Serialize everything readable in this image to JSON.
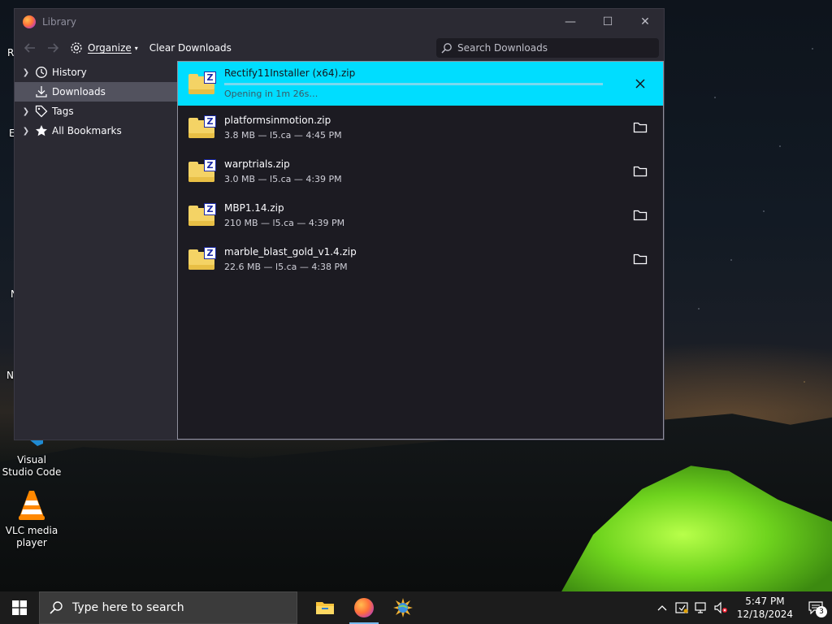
{
  "window": {
    "title": "Library",
    "controls": {
      "minimize": "—",
      "maximize": "☐",
      "close": "✕"
    }
  },
  "toolbar": {
    "back_icon": "arrow-left-icon",
    "forward_icon": "arrow-right-icon",
    "organize_label": "Organize",
    "clear_label": "Clear Downloads",
    "search_placeholder": "Search Downloads"
  },
  "sidebar": {
    "items": [
      {
        "label": "History",
        "icon": "clock-icon",
        "expandable": true
      },
      {
        "label": "Downloads",
        "icon": "download-icon",
        "expandable": false,
        "active": true
      },
      {
        "label": "Tags",
        "icon": "tag-icon",
        "expandable": true
      },
      {
        "label": "All Bookmarks",
        "icon": "star-icon",
        "expandable": true
      }
    ]
  },
  "downloads": [
    {
      "name": "Rectify11Installer (x64).zip",
      "status": "Opening in 1m 26s…",
      "progress": 0.0,
      "selected": true
    },
    {
      "name": "platformsinmotion.zip",
      "status": "3.8 MB — l5.ca — 4:45 PM"
    },
    {
      "name": "warptrials.zip",
      "status": "3.0 MB — l5.ca — 4:39 PM"
    },
    {
      "name": "MBP1.14.zip",
      "status": "210 MB — l5.ca — 4:39 PM"
    },
    {
      "name": "marble_blast_gold_v1.4.zip",
      "status": "22.6 MB — l5.ca — 4:38 PM"
    }
  ],
  "desktop": {
    "icons": [
      {
        "label": "Visual Studio Code"
      },
      {
        "label": "VLC media player"
      }
    ],
    "edge_labels": [
      "R",
      "E",
      "N",
      "N"
    ]
  },
  "taskbar": {
    "search_placeholder": "Type here to search",
    "time": "5:47 PM",
    "date": "12/18/2024",
    "notification_count": "3"
  },
  "colors": {
    "accent": "#00ddff",
    "progress": "#9059ff",
    "window_bg": "#2b2a33",
    "list_bg": "#1c1b22"
  }
}
